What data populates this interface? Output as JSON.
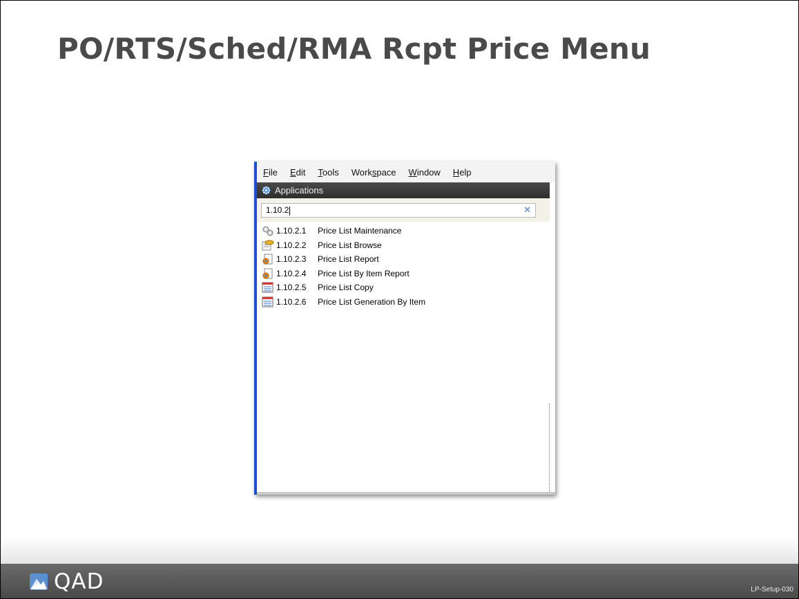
{
  "slide": {
    "title": "PO/RTS/Sched/RMA Rcpt Price Menu",
    "code": "LP-Setup-030"
  },
  "app": {
    "menu": [
      {
        "label": "File",
        "accel": "F",
        "rest": "ile"
      },
      {
        "label": "Edit",
        "accel": "E",
        "rest": "dit"
      },
      {
        "label": "Tools",
        "accel": "T",
        "rest": "ools"
      },
      {
        "label": "Workspace",
        "pre": "Work",
        "accel": "s",
        "rest": "pace"
      },
      {
        "label": "Window",
        "accel": "W",
        "rest": "indow"
      },
      {
        "label": "Help",
        "accel": "H",
        "rest": "elp"
      }
    ],
    "panel_title": "Applications",
    "search": {
      "value": "1.10.2"
    },
    "items": [
      {
        "number": "1.10.2.1",
        "label": "Price List Maintenance",
        "icon": "gears-icon"
      },
      {
        "number": "1.10.2.2",
        "label": "Price List Browse",
        "icon": "browse-icon"
      },
      {
        "number": "1.10.2.3",
        "label": "Price List Report",
        "icon": "report-icon"
      },
      {
        "number": "1.10.2.4",
        "label": "Price List By Item Report",
        "icon": "report-icon"
      },
      {
        "number": "1.10.2.5",
        "label": "Price List Copy",
        "icon": "form-icon"
      },
      {
        "number": "1.10.2.6",
        "label": "Price List Generation By Item",
        "icon": "form-icon"
      }
    ]
  },
  "footer": {
    "logo_text": "QAD"
  },
  "colors": {
    "accent_blue": "#1f4fd1",
    "title_gray": "#4a4a4a",
    "footer_gray": "#555555"
  }
}
